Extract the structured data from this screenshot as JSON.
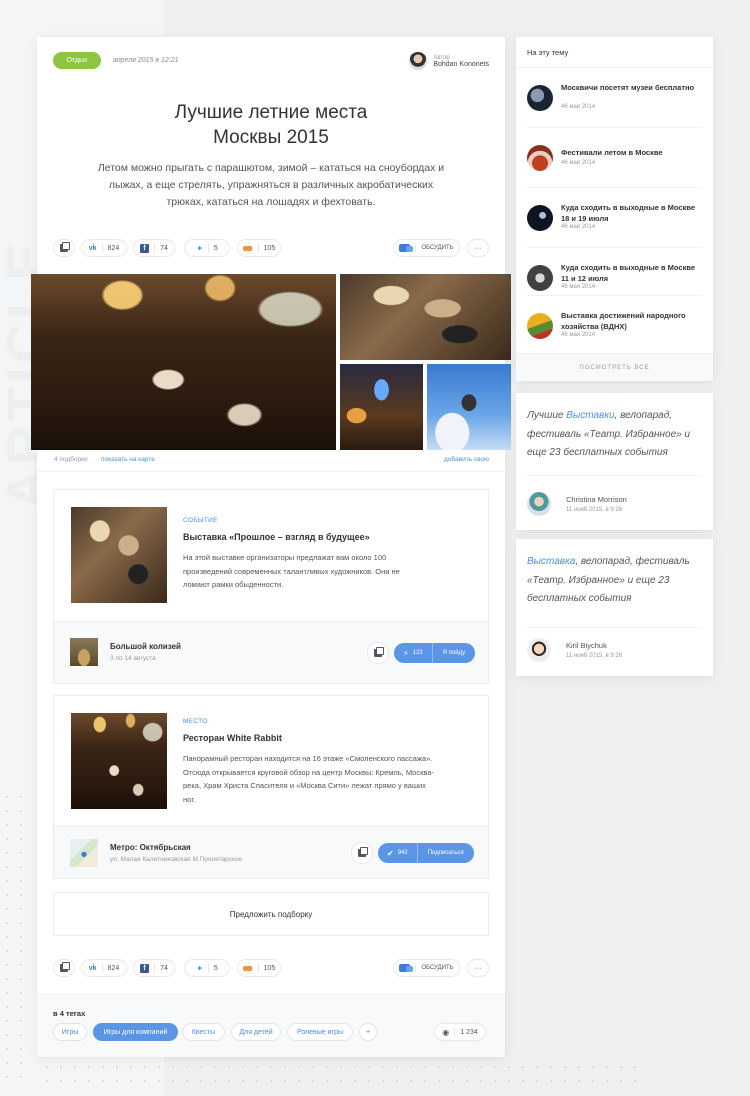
{
  "background_word": "ARTICLE",
  "colors": {
    "accent_green": "#8cc63f",
    "accent_blue": "#5b95e6",
    "link_blue": "#4a90e2"
  },
  "article": {
    "category": "Отдых",
    "date": "апреля 2015 в 12:21",
    "author_label": "Автор",
    "author_name": "Bohdan Kononets",
    "title_line1": "Лучшие летние места",
    "title_line2": "Москвы 2015",
    "lead": "Летом можно прыгать с парашютом, зимой – кататься на сноубордах и лыжах, а еще стрелять, упражняться в различных акробатических трюках, кататься на лошадях и фехтовать.",
    "share": {
      "vk_count": "824",
      "fb_count": "74",
      "tw_count": "5",
      "ok_count": "105",
      "discuss_label": "ОБСУДИТЬ",
      "more_label": "···"
    },
    "gallery": {
      "count_label": "4 подборки",
      "map_link": "показать на карте",
      "add_link": "добавить свою"
    }
  },
  "items": [
    {
      "kicker": "СОБЫТИЕ",
      "title": "Выставка «Прошлое – взгляд в будущее»",
      "text": "На этой выставке организаторы предлажат вам около 100 произведений современных талантливых художников. Они не ломают рамки обыденности.",
      "place_name": "Большой колизей",
      "place_sub": "3 по 14 августа",
      "action_count": "123",
      "action_label": "Я пойду"
    },
    {
      "kicker": "МЕСТО",
      "title": "Ресторан White Rabbit",
      "text": "Панорамный ресторан находится на 16 этаже «Смоленского пассажа». Отсюда открывается круговой обзор на центр Москвы: Кремль, Москва-река, Храм Христа Спасителя и «Москва Сити» лежат прямо у ваших ног.",
      "place_name": "Метро: Октябрьская",
      "place_sub": "ул. Малая Калитниковская М.Пролетарское",
      "action_count": "942",
      "action_label": "Подписаться"
    }
  ],
  "suggest_label": "Предложить подборку",
  "tags": {
    "heading": "в 4 тегах",
    "list": [
      "Игры",
      "Игры для компаний",
      "Квесты",
      "Для детей",
      "Ролевые игры",
      "+"
    ],
    "views": "1 234"
  },
  "sidebar": {
    "heading": "На эту тему",
    "items": [
      {
        "title": "Москвичи посетят музеи бесплатно",
        "date": "46 мая 2014"
      },
      {
        "title": "Фестивали летом в Москве",
        "date": "46 мая 2014"
      },
      {
        "title": "Куда сходить в выходные в Москве 18 и 19 июля",
        "date": "46 мая 2014"
      },
      {
        "title": "Куда сходить в выходные в Москве 11 и 12 июля",
        "date": "46 мая 2014"
      },
      {
        "title": "Выставка достижений народного хозяйства (ВДНХ)",
        "date": "46 мая 2014"
      }
    ],
    "more_label": "ПОСМОТРЕТЬ ВСЕ"
  },
  "quotes": [
    {
      "pre": "Лучшие ",
      "link": "Выставки",
      "post": ", велопарад, фестиваль «Театр. Избранное» и еще 23 бесплатных события",
      "name": "Christina Morrison",
      "date": "11 нояб 2015, в 9:26"
    },
    {
      "pre": "",
      "link": "Выставка",
      "post": ", велопарад, фестиваль «Театр. Избранное» и еще 23 бесплатных события",
      "name": "Kiril Biychuk",
      "date": "11 нояб 2015, в 9:26"
    }
  ]
}
